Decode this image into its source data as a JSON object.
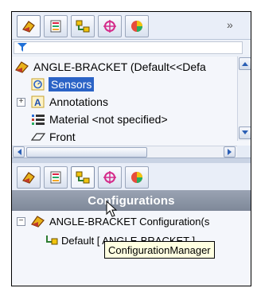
{
  "top_tabs": [
    {
      "icon": "feature-manager-icon"
    },
    {
      "icon": "property-manager-icon"
    },
    {
      "icon": "configuration-manager-icon"
    },
    {
      "icon": "dimxpert-manager-icon"
    },
    {
      "icon": "display-manager-icon"
    }
  ],
  "overflow_label": "»",
  "filter": {
    "icon": "filter-icon"
  },
  "tree": {
    "root_label": "ANGLE-BRACKET  (Default<<Defa",
    "items": [
      {
        "label": "Sensors",
        "selected": true,
        "icon": "sensors-icon"
      },
      {
        "label": "Annotations",
        "icon": "annotations-icon"
      },
      {
        "label": "Material <not specified>",
        "icon": "material-icon"
      },
      {
        "label": "Front",
        "icon": "plane-icon"
      }
    ]
  },
  "lower": {
    "header": "Configurations",
    "tooltip": "ConfigurationManager",
    "root_label": "ANGLE-BRACKET Configuration(s",
    "default_config": "Default [ ANGLE-BRACKET ]"
  },
  "colors": {
    "selection": "#2b63c6",
    "header": "#8a93a5",
    "tooltip_bg": "#ffffe1"
  }
}
